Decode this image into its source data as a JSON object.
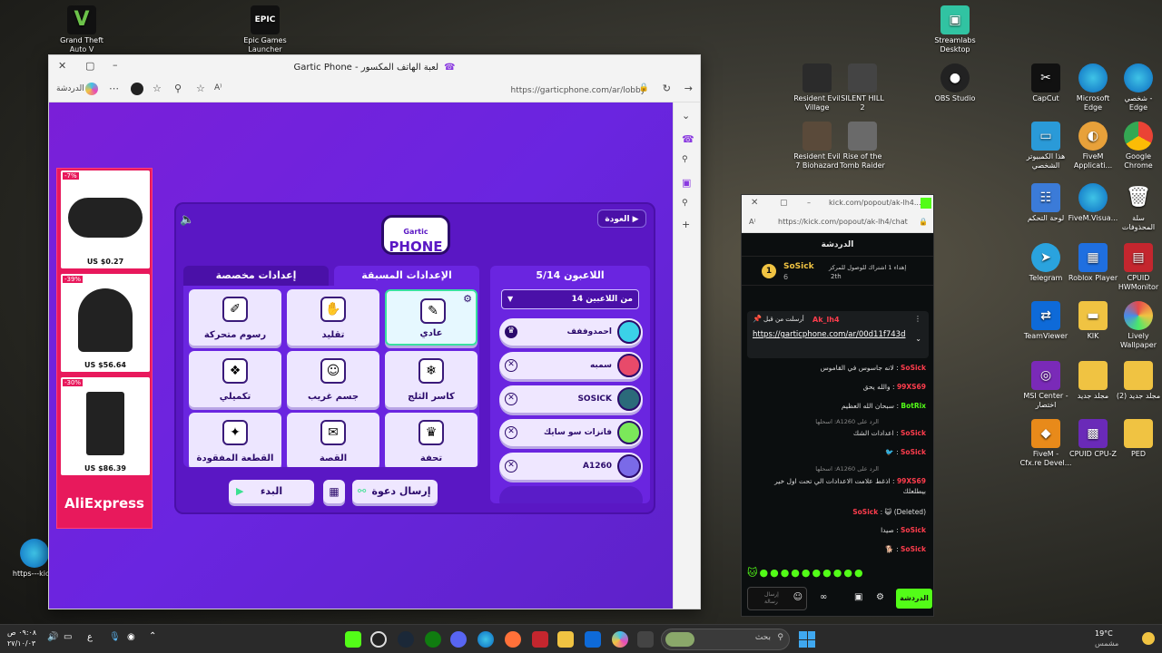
{
  "desktop": {
    "icons_left": [
      {
        "label": "Grand Theft\nAuto V",
        "glyph": "V",
        "color": "#1d1d1d"
      },
      {
        "label": "Epic Games\nLauncher",
        "glyph": "EPIC",
        "color": "#222222"
      }
    ],
    "icons_right": [
      {
        "label": "Streamlabs\nDesktop"
      },
      {
        "label": "Resident Evil\nVillage"
      },
      {
        "label": "SILENT HILL\n2"
      },
      {
        "label": "OBS Studio"
      },
      {
        "label": "CapCut"
      },
      {
        "label": "Microsoft\nEdge"
      },
      {
        "label": "شخصي -\nEdge"
      },
      {
        "label": "Resident Evil\n7 Biohazard"
      },
      {
        "label": "Rise of the\nTomb Raider"
      },
      {
        "label": "هذا الكمبيوتر\nالشخصي"
      },
      {
        "label": "FiveM\nApplicati..."
      },
      {
        "label": "Google\nChrome"
      },
      {
        "label": "لوحة التحكم"
      },
      {
        "label": "FiveM.Visua..."
      },
      {
        "label": "سلة\nالمحذوفات"
      },
      {
        "label": "Telegram"
      },
      {
        "label": "Roblox Player"
      },
      {
        "label": "CPUID\nHWMonitor"
      },
      {
        "label": "TeamViewer"
      },
      {
        "label": "KIK"
      },
      {
        "label": "Lively\nWallpaper"
      },
      {
        "label": "MSI Center -\nاختصار"
      },
      {
        "label": "مجلد جديد"
      },
      {
        "label": "(2) مجلد جديد"
      },
      {
        "label": "FiveM -\nCfx.re Devel..."
      },
      {
        "label": "CPUID CPU-Z"
      },
      {
        "label": "PED"
      },
      {
        "label": "https---kic..."
      }
    ]
  },
  "browser": {
    "title": "Gartic Phone - لعبة الهاتف المكسور",
    "url": "https://garticphone.com/ar/lobby",
    "chat_label": "الدردشة"
  },
  "ad": {
    "items": [
      {
        "badge": "-7%",
        "price": "US $0.27"
      },
      {
        "badge": "-39%",
        "price": "US $56.64"
      },
      {
        "badge": "-30%",
        "price": "US $86.39"
      }
    ],
    "brand": "AliExpress"
  },
  "game": {
    "logo_top": "Gartic",
    "logo_bottom": "PHONE",
    "back_label": "العودة",
    "tab_presets": "الإعدادات المسبقة",
    "tab_custom": "إعدادات مخصصة",
    "players_header": "اللاعبون 5/14",
    "players_select": "14 من اللاعبين",
    "modes": [
      {
        "label": "عادي",
        "icon": "✎",
        "selected": true
      },
      {
        "label": "تقليد",
        "icon": "✋"
      },
      {
        "label": "رسوم متحركة",
        "icon": "✐"
      },
      {
        "label": "كاسر الثلج",
        "icon": "❄"
      },
      {
        "label": "جسم غريب",
        "icon": "☺"
      },
      {
        "label": "تكميلي",
        "icon": "❖"
      },
      {
        "label": "تحفة",
        "icon": "♛"
      },
      {
        "label": "القصة",
        "icon": "✉"
      },
      {
        "label": "القطعة المفقودة",
        "icon": "✦"
      }
    ],
    "players": [
      {
        "name": "احمدوففف",
        "color": "#3bd1e8",
        "host": true
      },
      {
        "name": "سمبه",
        "color": "#e84a6a"
      },
      {
        "name": "SOSICK",
        "color": "#2b6a7a"
      },
      {
        "name": "فانزات سو سايك",
        "color": "#7be85a"
      },
      {
        "name": "A1260",
        "color": "#7a6ae8"
      }
    ],
    "start_label": "البدء",
    "invite_label": "إرسال دعوة"
  },
  "kick": {
    "window_url_short": "kick.com/popout/ak-lh4...",
    "url": "https://kick.com/popout/ak-lh4/chat",
    "header": "الدردشة",
    "top_user": "SoSick",
    "top_user_count": "6",
    "top_gift": "إهداء 1 اشتراك للوصول للمركز",
    "top_gift_rank": "2th",
    "pinned_by": "أرسلت من قبل",
    "pinned_user": "Ak_lh4",
    "pinned_link": "https://garticphone.com/ar/00d11f743d",
    "messages": [
      {
        "user": "SoSick",
        "text": "لانه جاسوس في القاموس"
      },
      {
        "user": "99XS69",
        "text": "والله يحق"
      },
      {
        "user": "BotRix",
        "text": "سبحان الله العظيم"
      },
      {
        "reply": "الرد على A1260: اسحلها"
      },
      {
        "user": "SoSick",
        "text": "اعدادات الشك"
      },
      {
        "user": "SoSick",
        "text": ""
      },
      {
        "reply": "الرد على A1260: اسحلها"
      },
      {
        "user": "99XS69",
        "text": "اذغط علامت الاعدادات الي تحت اول خير بيطلعلك"
      },
      {
        "user": "SoSick",
        "text": "(Deleted)"
      },
      {
        "user": "SoSick",
        "text": "صيدا"
      },
      {
        "user": "SoSick",
        "text": ""
      }
    ],
    "input_hint": "إرسال رسالة",
    "send_label": "الدردشة"
  },
  "taskbar": {
    "search_placeholder": "بحث",
    "weather_temp": "19°C",
    "weather_desc": "مشمس",
    "time": "٠٩:٠٨ ص",
    "date": "٢٧/١٠/٠٣",
    "lang": "ع"
  }
}
